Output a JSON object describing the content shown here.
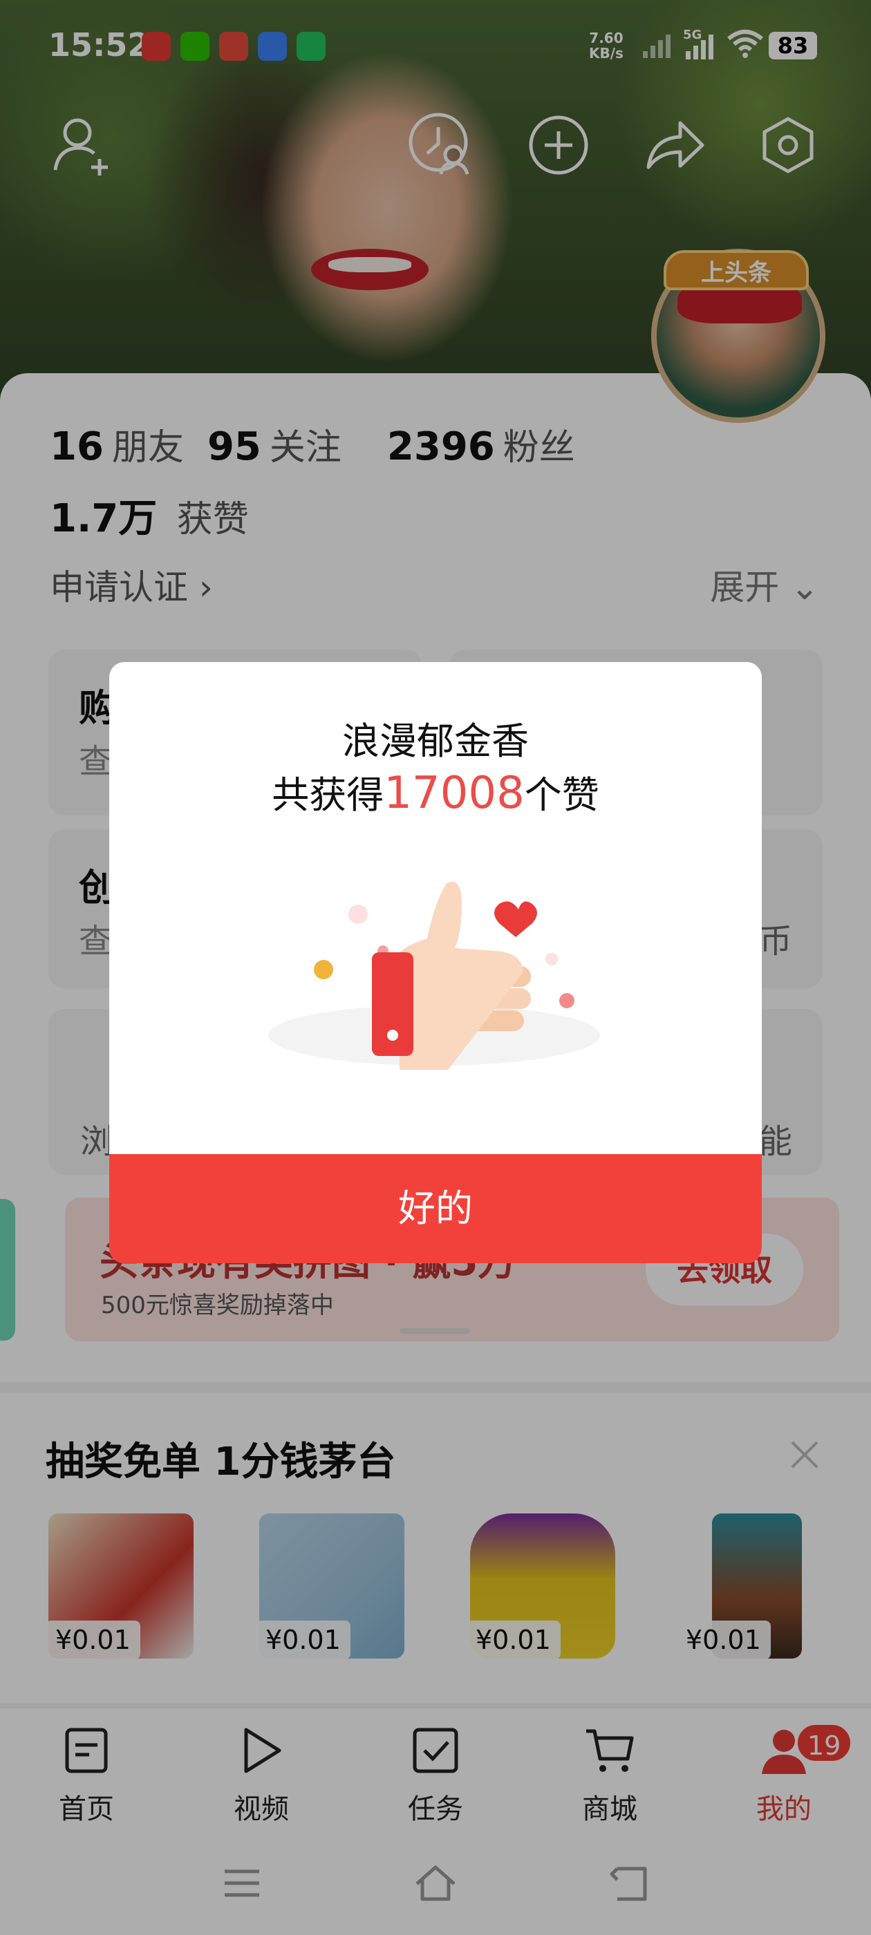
{
  "status_bar": {
    "time": "15:52",
    "net_speed_value": "7.60",
    "net_speed_unit": "KB/s",
    "network": "5G",
    "battery": "83"
  },
  "avatar": {
    "banner": "上头条"
  },
  "profile": {
    "friends_count": "16",
    "friends_label": "朋友",
    "following_count": "95",
    "following_label": "关注",
    "fans_count": "2396",
    "fans_label": "粉丝",
    "likes_count": "1.7万",
    "likes_label": "获赞",
    "certify_label": "申请认证 ›",
    "expand_label": "展开 ⌄"
  },
  "tiles": {
    "tile1_title": "购",
    "tile1_sub": "查",
    "tile2_title": "创",
    "tile2_sub": "查",
    "tile2_right": "币",
    "tile3_left": "浏",
    "tile3_right": "能"
  },
  "banner": {
    "title": "头条现有奖拼图 · 赢5万",
    "subtitle": "500元惊喜奖励掉落中",
    "button": "去领取"
  },
  "lottery": {
    "title": "抽奖免单 1分钱茅台",
    "products": [
      {
        "price": "¥0.01",
        "color": "#c9352b"
      },
      {
        "price": "¥0.01",
        "color": "#9ec4dc"
      },
      {
        "price": "¥0.01",
        "color": "#e3c41f"
      },
      {
        "price": "¥0.01",
        "color": "#2e8ea0"
      }
    ]
  },
  "tabs": [
    {
      "label": "首页",
      "icon": "home-doc-icon"
    },
    {
      "label": "视频",
      "icon": "play-icon"
    },
    {
      "label": "任务",
      "icon": "task-check-icon"
    },
    {
      "label": "商城",
      "icon": "cart-icon"
    },
    {
      "label": "我的",
      "icon": "profile-icon"
    }
  ],
  "tab_badge": "19",
  "dialog": {
    "name": "浪漫郁金香",
    "count_prefix": "共获得",
    "count_number": "17008",
    "count_suffix": "个赞",
    "ok_button": "好的"
  },
  "colors": {
    "accent_red": "#f2413b",
    "highlight_number": "#ea4d4a"
  }
}
